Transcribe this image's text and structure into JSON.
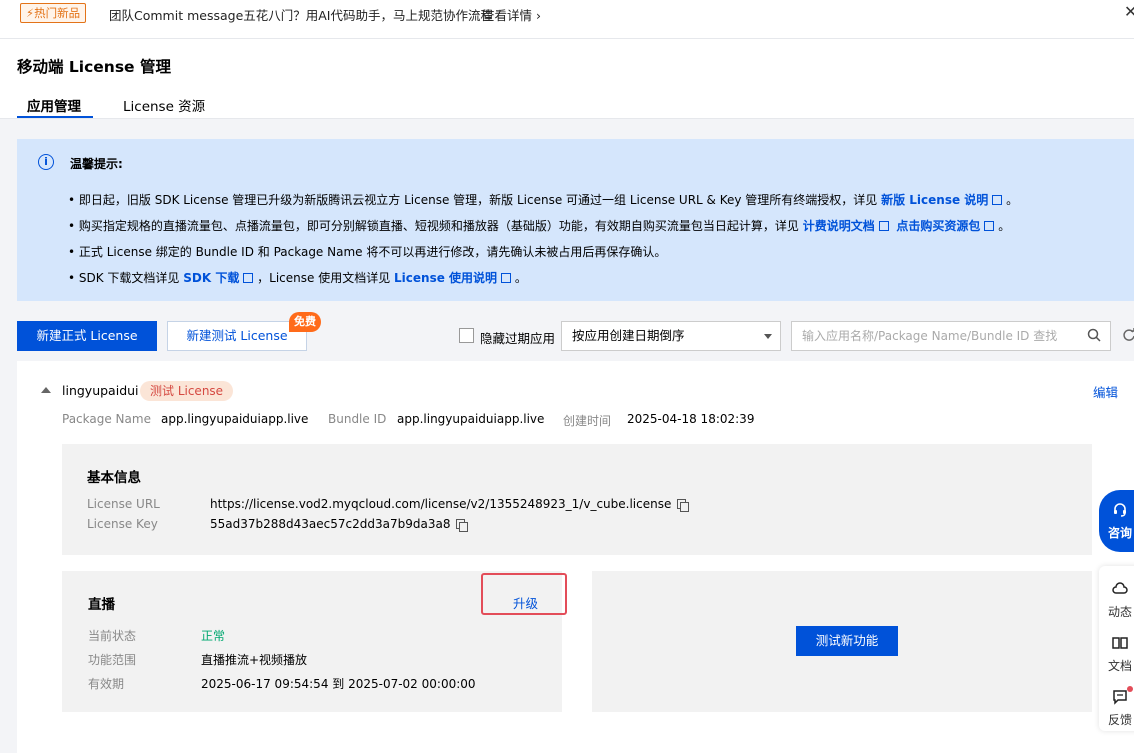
{
  "banner": {
    "badge": "⚡热门新品",
    "text": "团队Commit message五花八门？用AI代码助手，马上规范协作流程",
    "link": "查看详情 ›",
    "close": "✕"
  },
  "header": {
    "title": "移动端 License 管理",
    "tabs": [
      {
        "label": "应用管理",
        "active": true
      },
      {
        "label": "License 资源",
        "active": false
      }
    ]
  },
  "notice": {
    "title": "温馨提示:",
    "lines": [
      {
        "text": "• 即日起，旧版 SDK License 管理已升级为新版腾讯云视立方 License 管理，新版 License 可通过一组 License URL & Key 管理所有终端授权，详见 ",
        "links": [
          "新版 License 说明"
        ],
        "tail": " 。"
      },
      {
        "text": "• 购买指定规格的直播流量包、点播流量包，即可分别解锁直播、短视频和播放器（基础版）功能，有效期自购买流量包当日起计算，详见 ",
        "links": [
          "计费说明文档",
          "点击购买资源包"
        ],
        "tail": " 。"
      },
      {
        "text": "• 正式 License 绑定的 Bundle ID 和 Package Name 将不可以再进行修改，请先确认未被占用后再保存确认。",
        "links": [],
        "tail": ""
      },
      {
        "text": "• SDK 下载文档详见 ",
        "links": [
          "SDK 下载"
        ],
        "mid": " ，License 使用文档详见 ",
        "links2": [
          "License 使用说明"
        ],
        "tail": " 。"
      }
    ]
  },
  "toolbar": {
    "new_formal": "新建正式 License",
    "new_test": "新建测试 License",
    "free_badge": "免费",
    "hide_expired": "隐藏过期应用",
    "sort_value": "按应用创建日期倒序",
    "search_placeholder": "输入应用名称/Package Name/Bundle ID 查找"
  },
  "app": {
    "name": "lingyupaidui",
    "badge": "测试 License",
    "edit": "编辑",
    "package_name_label": "Package Name",
    "package_name": "app.lingyupaiduiapp.live",
    "bundle_id_label": "Bundle ID",
    "bundle_id": "app.lingyupaiduiapp.live",
    "created_label": "创建时间",
    "created": "2025-04-18 18:02:39",
    "basic": {
      "title": "基本信息",
      "url_label": "License URL",
      "url": "https://license.vod2.myqcloud.com/license/v2/1355248923_1/v_cube.license",
      "key_label": "License Key",
      "key": "55ad37b288d43aec57c2dd3a7b9da3a8"
    },
    "live": {
      "title": "直播",
      "upgrade": "升级",
      "status_label": "当前状态",
      "status": "正常",
      "scope_label": "功能范围",
      "scope": "直播推流+视频播放",
      "validity_label": "有效期",
      "validity": "2025-06-17 09:54:54 到 2025-07-02 00:00:00"
    },
    "test_feature": "测试新功能"
  },
  "side": {
    "consult": "咨询",
    "items": [
      {
        "label": "动态",
        "icon": "cloud-icon"
      },
      {
        "label": "文档",
        "icon": "book-icon"
      },
      {
        "label": "反馈",
        "icon": "feedback-icon"
      }
    ]
  },
  "colors": {
    "primary": "#0052d9",
    "notice_bg": "#d5e6fc",
    "warning": "#e37318",
    "success": "#00a870",
    "danger": "#e34d59"
  }
}
